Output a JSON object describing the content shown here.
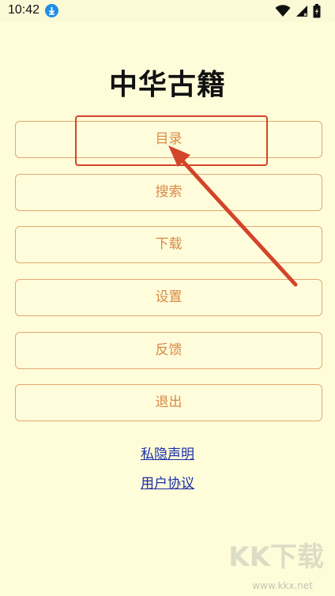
{
  "status_bar": {
    "time": "10:42",
    "icons": [
      "download-icon",
      "wifi-icon",
      "signal-icon",
      "battery-icon"
    ]
  },
  "app": {
    "title": "中华古籍"
  },
  "menu": [
    {
      "label": "目录"
    },
    {
      "label": "搜索"
    },
    {
      "label": "下载"
    },
    {
      "label": "设置"
    },
    {
      "label": "反馈"
    },
    {
      "label": "退出"
    }
  ],
  "links": {
    "privacy": "私隐声明",
    "agreement": "用户协议"
  },
  "watermark": {
    "text": "KK下载",
    "url": "www.kkx.net"
  },
  "colors": {
    "background": "#fefcd9",
    "button_border": "#e3a773",
    "button_text": "#d98a47",
    "link": "#1a2ea8",
    "annotation": "#d2452a"
  }
}
